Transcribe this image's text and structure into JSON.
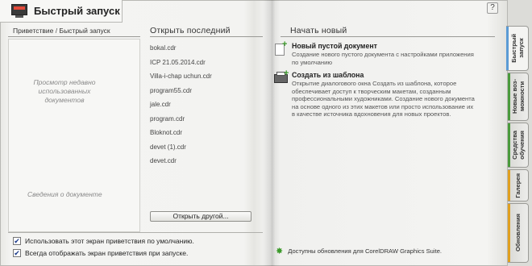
{
  "header": {
    "title": "Быстрый запуск",
    "help_symbol": "?"
  },
  "breadcrumb": {
    "first": "Приветствие",
    "separator": " / ",
    "current": "Быстрый запуск"
  },
  "preview": {
    "placeholder": "Просмотр недавно использованных документов",
    "doc_info": "Сведения о документе"
  },
  "recent": {
    "heading": "Открыть последний",
    "files": [
      "bokal.cdr",
      "ICP 21.05.2014.cdr",
      "Villa-i-chap uchun.cdr",
      "program55.cdr",
      "jale.cdr",
      "program.cdr",
      "Bloknot.cdr",
      "devet (1).cdr",
      "devet.cdr"
    ],
    "open_other_label": "Открыть другой..."
  },
  "start_new": {
    "heading": "Начать новый",
    "new_doc": {
      "title": "Новый пустой документ",
      "desc": "Создание нового пустого документа с настройками приложения по умолчанию"
    },
    "from_template": {
      "title": "Создать из шаблона",
      "desc": "Открытие диалогового окна Создать из шаблона, которое обеспечивает доступ к творческим макетам, созданным профессиональными художниками. Создание нового документа на основе одного из этих макетов или просто использование их в качестве источника вдохновения для новых проектов."
    }
  },
  "options": {
    "use_default": "Использовать этот экран приветствия по умолчанию.",
    "always_show": "Всегда отображать экран приветствия при запуске.",
    "check_mark": "✔"
  },
  "updates_text": "Доступны обновления для CorelDRAW Graphics Suite.",
  "tabs": [
    {
      "label": "Быстрый\nзапуск"
    },
    {
      "label": "Новые воз-\nможности"
    },
    {
      "label": "Средства\nобучения"
    },
    {
      "label": "Галерея"
    },
    {
      "label": "Обновления"
    }
  ],
  "colors": {
    "accent_green": "#3c9a2b",
    "tab_blue": "#5b9bd5",
    "tab_green": "#4a9a3c",
    "tab_orange": "#e0a020"
  }
}
